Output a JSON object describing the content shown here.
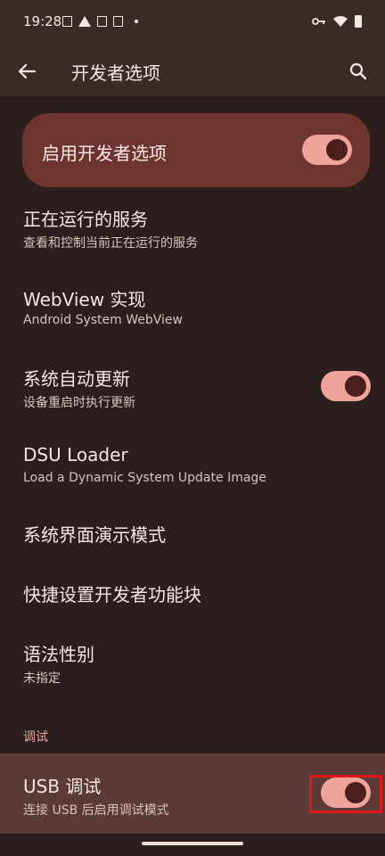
{
  "status_bar": {
    "time": "19:28"
  },
  "toolbar": {
    "title": "开发者选项"
  },
  "master_switch": {
    "label": "启用开发者选项",
    "on": true
  },
  "settings": [
    {
      "title": "正在运行的服务",
      "subtitle": "查看和控制当前正在运行的服务"
    },
    {
      "title": "WebView 实现",
      "subtitle": "Android System WebView"
    },
    {
      "title": "系统自动更新",
      "subtitle": "设备重启时执行更新",
      "toggle_on": true
    },
    {
      "title": "DSU Loader",
      "subtitle": "Load a Dynamic System Update Image"
    },
    {
      "title": "系统界面演示模式"
    },
    {
      "title": "快捷设置开发者功能块"
    },
    {
      "title": "语法性别",
      "subtitle": "未指定"
    }
  ],
  "debug_section": {
    "header": "调试",
    "usb_debugging": {
      "title": "USB 调试",
      "subtitle": "连接 USB 后启用调试模式",
      "toggle_on": true
    }
  },
  "colors": {
    "background": "#2b1f1e",
    "accent_card": "#6e3430",
    "switch_track": "#f0a39b",
    "switch_thumb": "#4a1f1c",
    "highlight": "#e01515"
  }
}
